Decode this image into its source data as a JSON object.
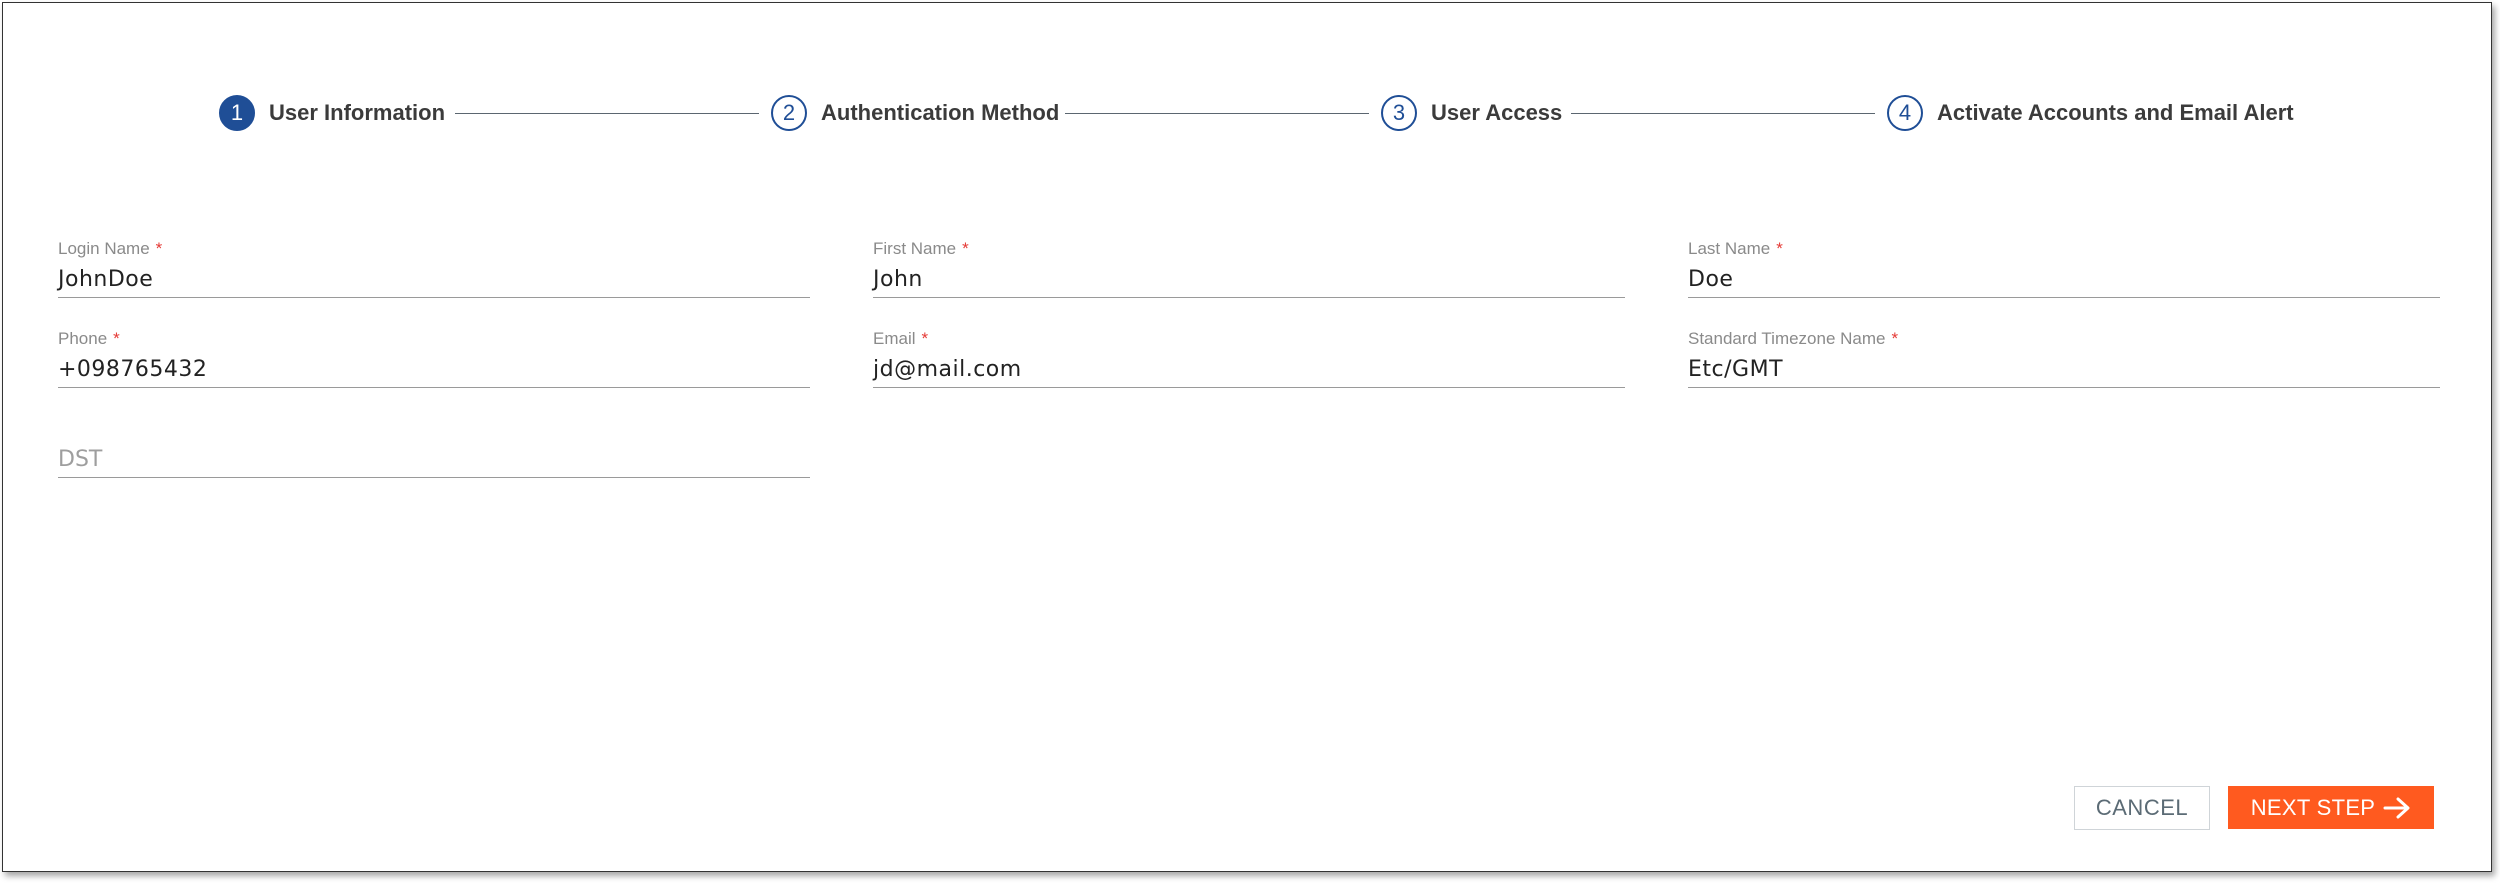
{
  "stepper": {
    "steps": [
      {
        "number": "1",
        "label": "User Information",
        "active": true
      },
      {
        "number": "2",
        "label": "Authentication Method",
        "active": false
      },
      {
        "number": "3",
        "label": "User Access",
        "active": false
      },
      {
        "number": "4",
        "label": "Activate Accounts and Email Alert",
        "active": false
      }
    ]
  },
  "form": {
    "login_name": {
      "label": "Login Name",
      "required_mark": "*",
      "value": "JohnDoe"
    },
    "first_name": {
      "label": "First Name",
      "required_mark": "*",
      "value": "John"
    },
    "last_name": {
      "label": "Last Name",
      "required_mark": "*",
      "value": "Doe"
    },
    "phone": {
      "label": "Phone",
      "required_mark": "*",
      "value": "+098765432"
    },
    "email": {
      "label": "Email",
      "required_mark": "*",
      "value": "jd@mail.com"
    },
    "timezone": {
      "label": "Standard Timezone Name",
      "required_mark": "*",
      "value": "Etc/GMT"
    },
    "dst": {
      "placeholder": "DST",
      "value": ""
    }
  },
  "actions": {
    "cancel_label": "CANCEL",
    "next_label": "NEXT STEP"
  },
  "colors": {
    "primary": "#1f4e96",
    "accent": "#ff5a1f",
    "required": "#e53935"
  },
  "icons": {
    "next": "arrow-right-icon"
  }
}
